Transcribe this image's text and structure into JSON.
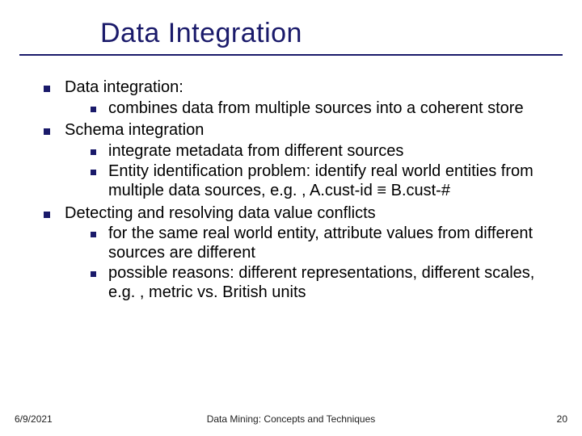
{
  "title": "Data Integration",
  "bullets": [
    {
      "text": "Data integration:",
      "children": [
        {
          "text": "combines data from multiple sources into a coherent store"
        }
      ]
    },
    {
      "text": "Schema integration",
      "children": [
        {
          "text": "integrate metadata from different sources"
        },
        {
          "text": "Entity identification problem: identify real world entities from multiple data sources, e.g. , A.cust-id ≡ B.cust-#"
        }
      ]
    },
    {
      "text": "Detecting and resolving data value conflicts",
      "children": [
        {
          "text": "for the same real world entity, attribute values from different sources are different"
        },
        {
          "text": "possible reasons: different representations, different scales, e.g. , metric vs. British units"
        }
      ]
    }
  ],
  "footer": {
    "date": "6/9/2021",
    "center": "Data Mining: Concepts and Techniques",
    "page": "20"
  }
}
